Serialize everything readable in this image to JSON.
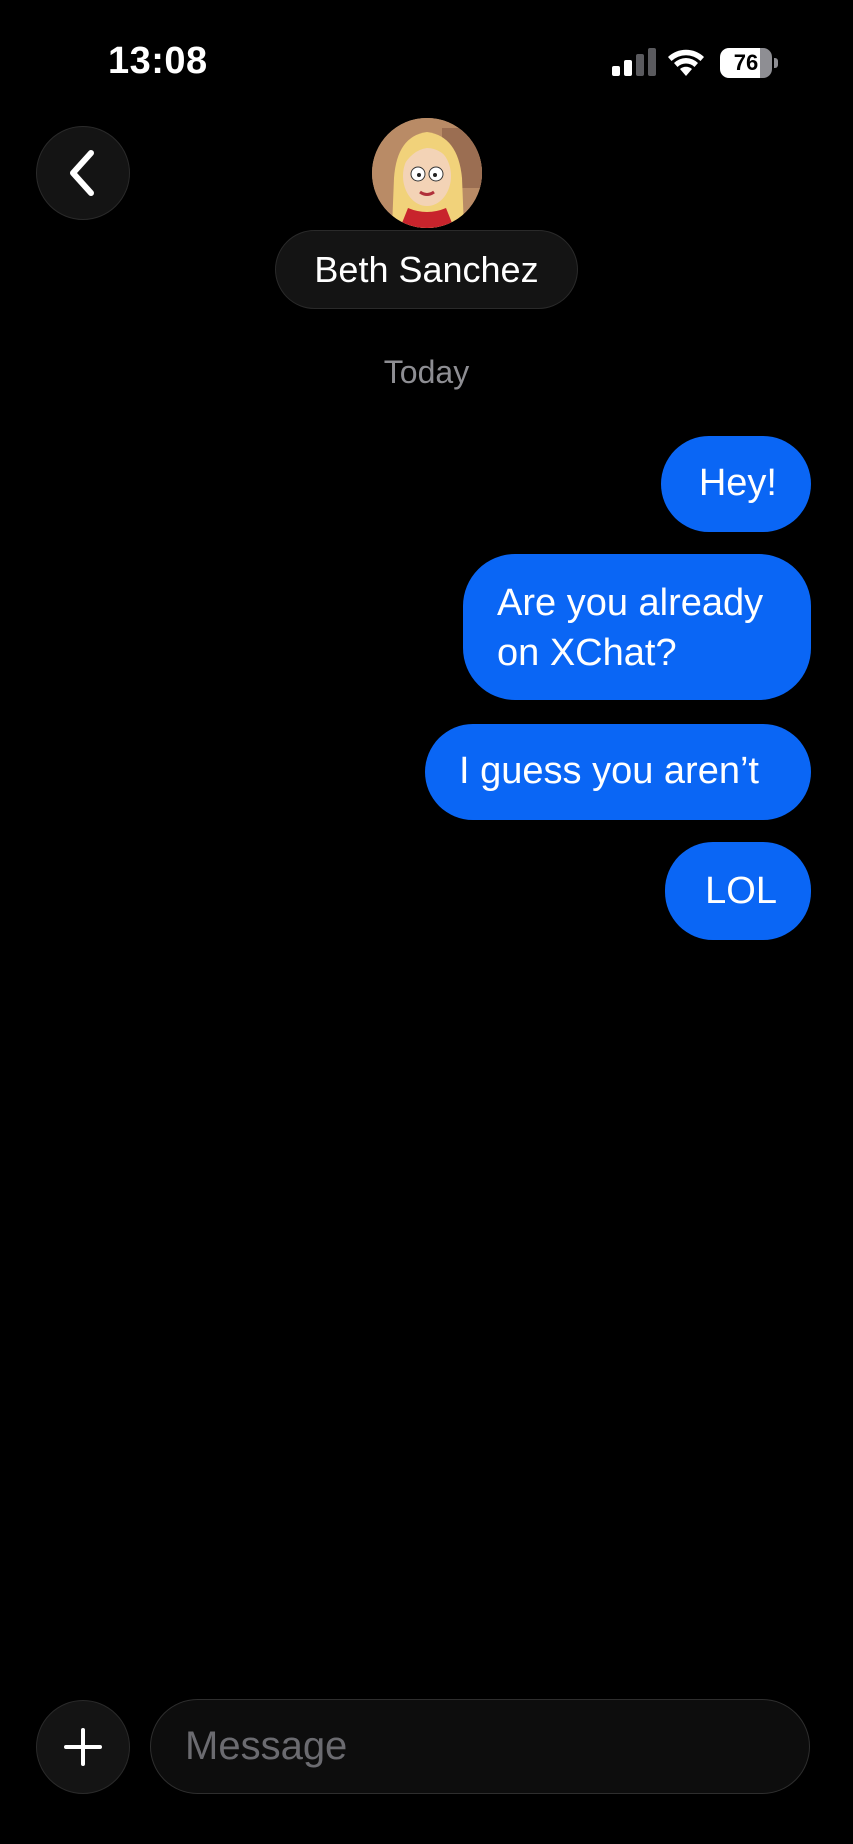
{
  "status_bar": {
    "time": "13:08",
    "battery": "76",
    "battery_level": 0.76,
    "icons": [
      "cellular-signal-icon",
      "wifi-icon",
      "battery-icon"
    ]
  },
  "header": {
    "back_icon": "chevron-left-icon",
    "contact_name": "Beth Sanchez",
    "avatar": "contact-avatar"
  },
  "conversation": {
    "date_label": "Today",
    "messages": [
      {
        "sender": "me",
        "text": "Hey!"
      },
      {
        "sender": "me",
        "text": "Are you already on XChat?"
      },
      {
        "sender": "me",
        "text": "I guess you aren’t"
      },
      {
        "sender": "me",
        "text": "LOL"
      }
    ]
  },
  "composer": {
    "add_icon": "plus-icon",
    "placeholder": "Message",
    "value": ""
  },
  "colors": {
    "background": "#000000",
    "outgoing_bubble": "#0a66f5",
    "secondary_text": "#8e8e93",
    "control_fill": "#141414"
  }
}
